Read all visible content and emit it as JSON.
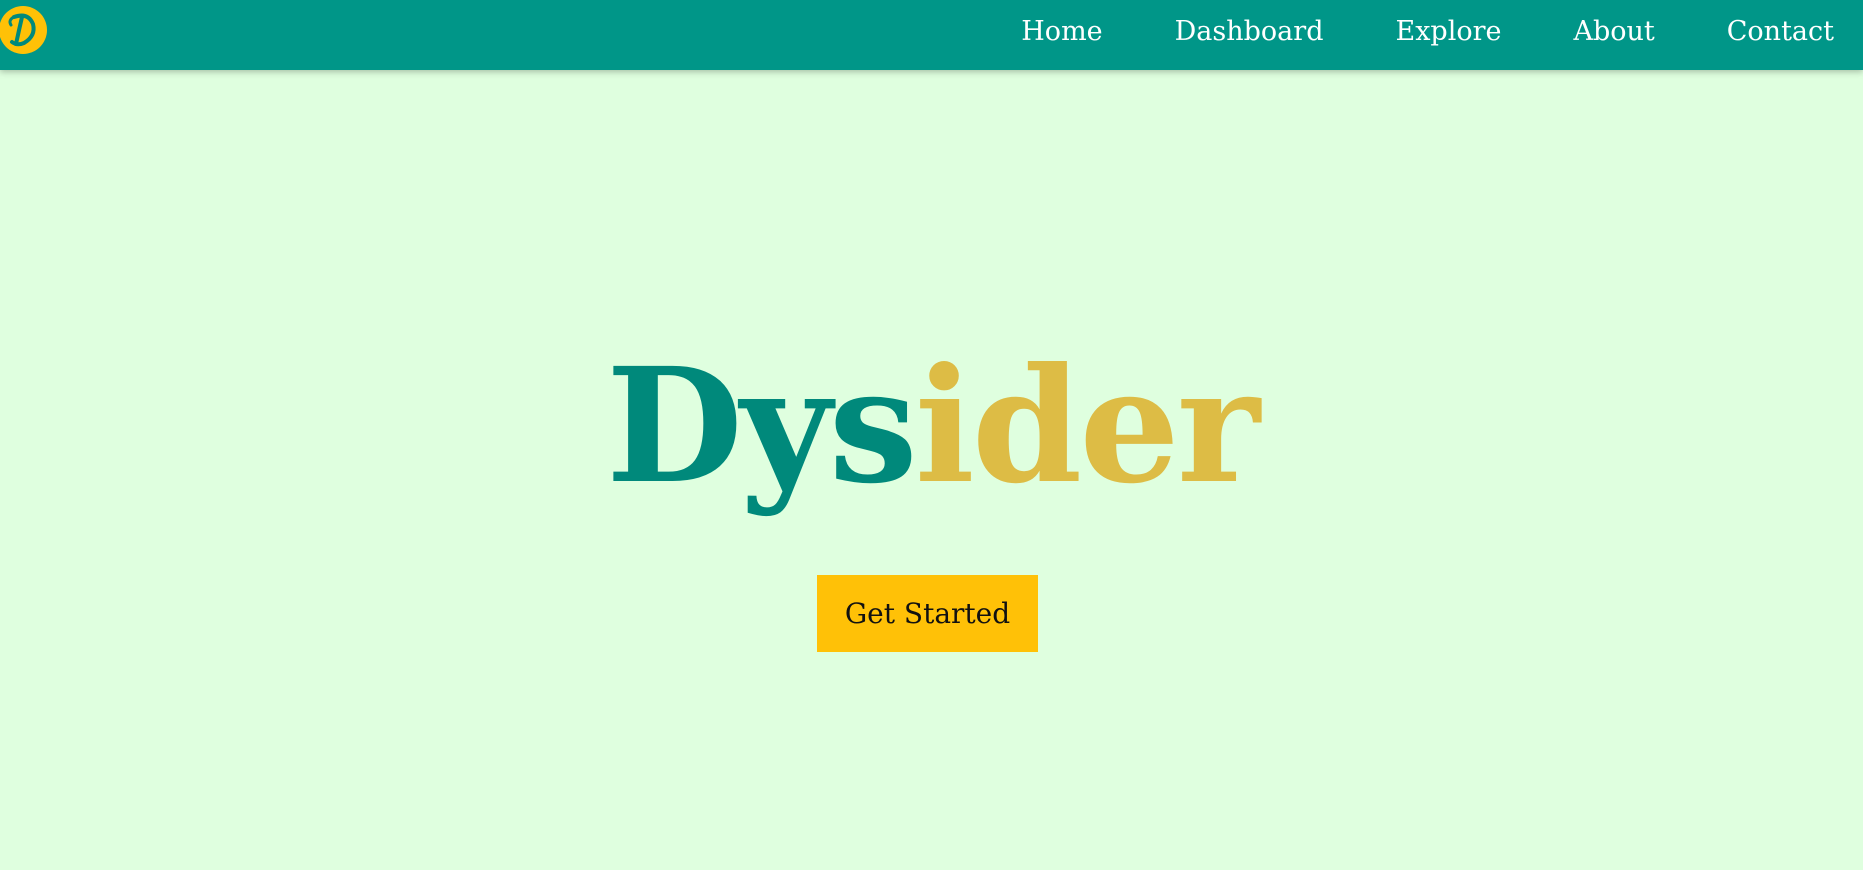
{
  "navbar": {
    "logo_icon": "dysider-logo-icon",
    "links": [
      "Home",
      "Dashboard",
      "Explore",
      "About",
      "Contact"
    ]
  },
  "hero": {
    "title_part_1": "Dys",
    "title_part_2": "ider",
    "cta_label": "Get Started"
  },
  "colors": {
    "navbar_bg": "#009688",
    "page_bg": "#dfffdf",
    "title_teal": "#00897b",
    "title_gold": "#ddbc45",
    "button_bg": "#ffc107"
  }
}
